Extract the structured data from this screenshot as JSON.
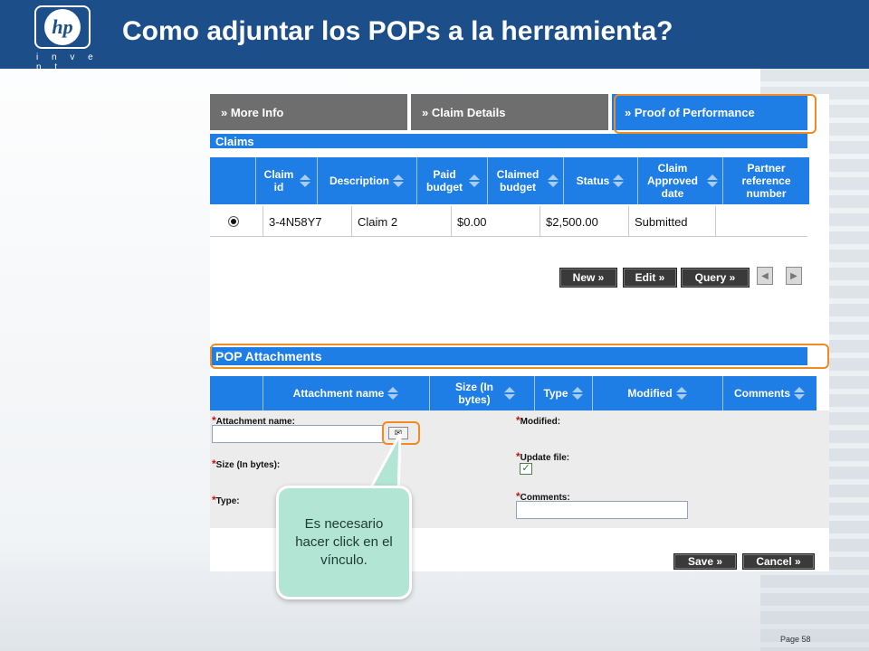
{
  "slide": {
    "title": "Como adjuntar los POPs  a la herramienta?",
    "logo_text": "hp",
    "logo_tagline": "i n v e n t",
    "page_number": "Page 58"
  },
  "tabs": [
    {
      "label": "» More Info"
    },
    {
      "label": "» Claim Details"
    },
    {
      "label": "» Proof of Performance",
      "active": true
    }
  ],
  "claims": {
    "section_title": "Claims",
    "columns": [
      "",
      "Claim id",
      "Description",
      "Paid budget",
      "Claimed budget",
      "Status",
      "Claim Approved date",
      "Partner reference number"
    ],
    "row": {
      "claim_id": "3-4N58Y7",
      "description": "Claim 2",
      "paid_budget": "$0.00",
      "claimed_budget": "$2,500.00",
      "status": "Submitted",
      "approved_date": "",
      "partner_ref": ""
    },
    "buttons": {
      "new": "New »",
      "edit": "Edit »",
      "query": "Query »",
      "prev": "◀",
      "next": "▶"
    }
  },
  "pop": {
    "section_title": "POP Attachments",
    "columns": [
      "",
      "Attachment name",
      "Size (In bytes)",
      "Type",
      "Modified",
      "Comments"
    ],
    "form": {
      "attachment_name_label": "Attachment name:",
      "size_label": "Size (In bytes):",
      "type_label": "Type:",
      "modified_label": "Modified:",
      "update_file_label": "Update file:",
      "comments_label": "Comments:",
      "required_mark": "*",
      "attachment_name_value": "",
      "comments_value": "",
      "update_file_checked": true
    },
    "buttons": {
      "save": "Save »",
      "cancel": "Cancel »"
    }
  },
  "callout": {
    "text": "Es necesario hacer click en el vínculo."
  },
  "colors": {
    "header": "#1c4e8a",
    "grid_blue": "#1f7de6",
    "highlight_orange": "#f08a24",
    "callout": "#b3e5d4"
  },
  "icons": [
    "hp-logo-icon",
    "sort-icon",
    "attach-icon",
    "checkbox-icon",
    "prev-icon",
    "next-icon"
  ]
}
